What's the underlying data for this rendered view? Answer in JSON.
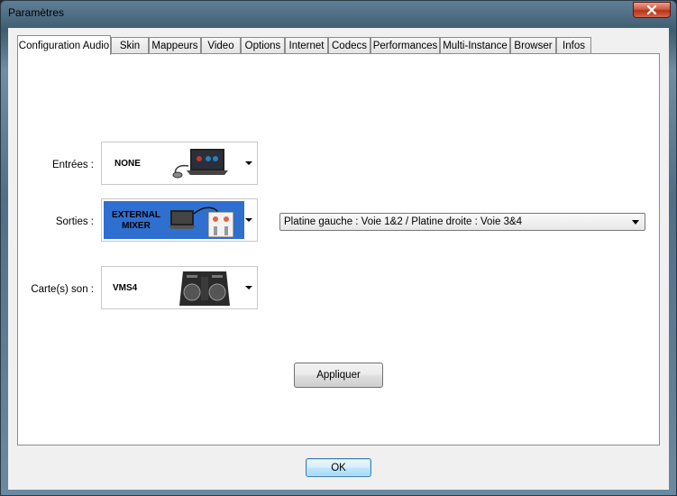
{
  "window": {
    "title": "Paramètres"
  },
  "tabs": [
    {
      "label": "Configuration Audio",
      "active": true
    },
    {
      "label": "Skin"
    },
    {
      "label": "Mappeurs"
    },
    {
      "label": "Video"
    },
    {
      "label": "Options"
    },
    {
      "label": "Internet"
    },
    {
      "label": "Codecs"
    },
    {
      "label": "Performances"
    },
    {
      "label": "Multi-Instance"
    },
    {
      "label": "Browser"
    },
    {
      "label": "Infos"
    }
  ],
  "audio": {
    "inputs": {
      "label": "Entrées :",
      "device": "NONE"
    },
    "outputs": {
      "label": "Sorties :",
      "device_line1": "EXTERNAL",
      "device_line2": "MIXER",
      "routing": "Platine gauche : Voie 1&2 / Platine droite : Voie 3&4"
    },
    "soundcard": {
      "label": "Carte(s) son :",
      "device": "VMS4"
    },
    "apply_label": "Appliquer"
  },
  "footer": {
    "ok_label": "OK"
  },
  "colors": {
    "selected_device_bg": "#2f6fd0",
    "close_button": "#c8432a"
  }
}
